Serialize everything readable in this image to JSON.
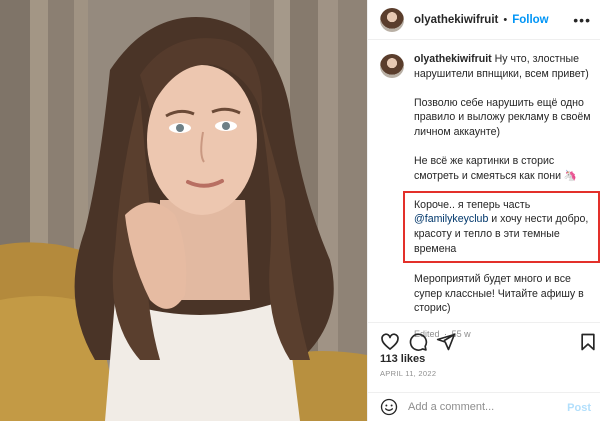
{
  "post": {
    "username": "olyathekiwifruit",
    "follow_label": "Follow",
    "header_separator": "•",
    "more_label": "•••"
  },
  "caption": {
    "username": "olyathekiwifruit",
    "paragraph_1": "Ну что, злостные нарушители впнщики, всем привет)",
    "paragraph_2": "Позволю себе нарушить ещё одно правило и выложу рекламу в своём личном аккаунте)",
    "paragraph_3": "Не всё же картинки в сторис смотреть и смеяться как пони 🦄",
    "paragraph_4_start": "Короче.. я теперь часть ",
    "paragraph_4_mention": "@familykeyclub",
    "paragraph_4_end": " и хочу нести добро, красоту и тепло в эти темные времена",
    "paragraph_5": "Мероприятий будет много и все супер классные! Читайте афишу в сторис)",
    "edited": "Edited",
    "time_sep": "·",
    "age": "55 w"
  },
  "stats": {
    "likes": "113 likes",
    "date": "APRIL 11, 2022"
  },
  "comment": {
    "placeholder": "Add a comment...",
    "post_label": "Post"
  },
  "icons": {
    "like": "heart-icon",
    "comment": "comment-icon",
    "share": "share-icon",
    "save": "bookmark-icon",
    "emoji": "emoji-icon"
  },
  "colors": {
    "accent": "#0095f6",
    "highlight_box": "#e3302a",
    "mention": "#00376b",
    "muted": "#8e8e8e"
  }
}
